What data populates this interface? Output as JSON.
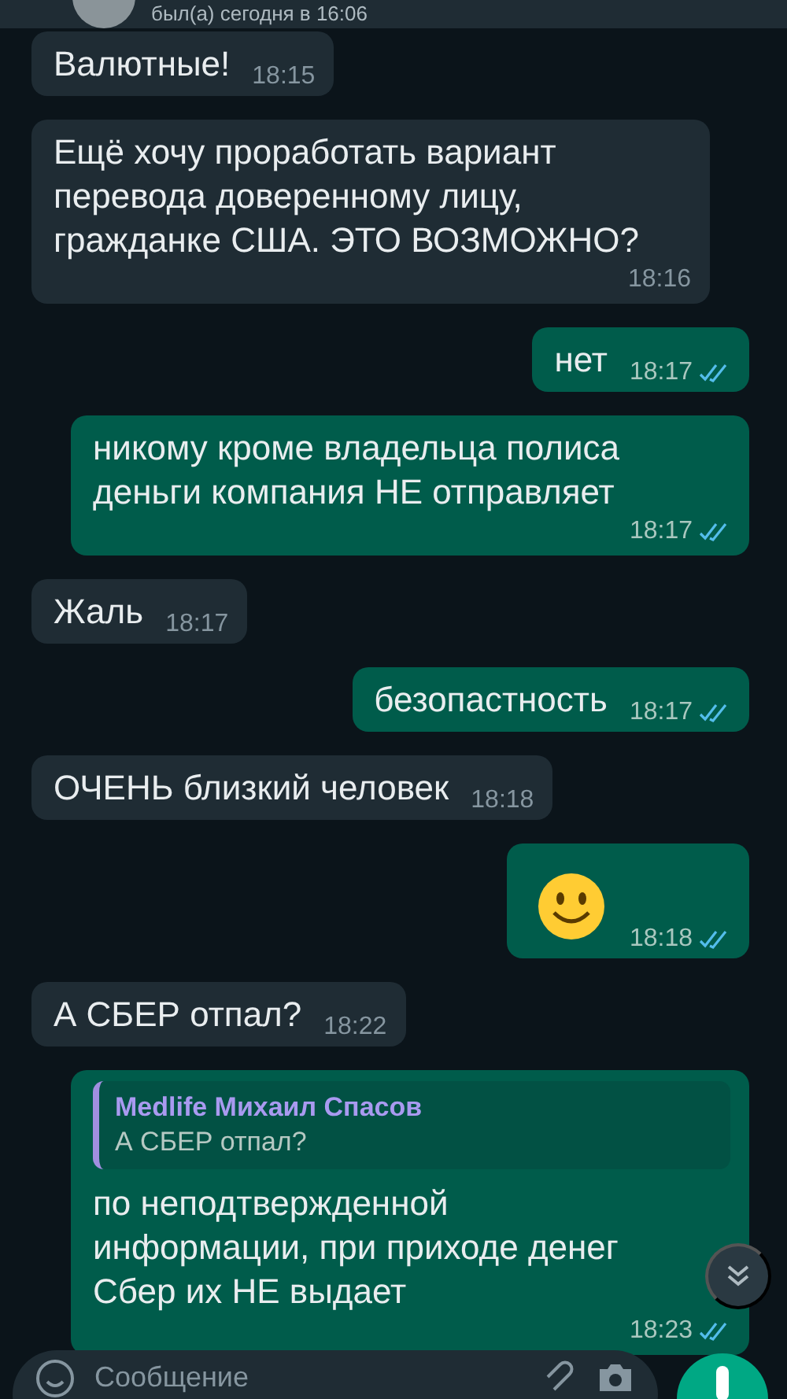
{
  "header": {
    "status": "был(а) сегодня в 16:06"
  },
  "messages": [
    {
      "kind": "text",
      "outgoing": false,
      "text": "Валютные!",
      "time": "18:15"
    },
    {
      "kind": "text",
      "outgoing": false,
      "text": "Ещё хочу проработать вариант\nперевода доверенному лицу,\nгражданке США. ЭТО ВОЗМОЖНО?",
      "time": "18:16"
    },
    {
      "kind": "text",
      "outgoing": true,
      "text": "нет",
      "time": "18:17",
      "read": true
    },
    {
      "kind": "text",
      "outgoing": true,
      "text": "никому кроме владельца полиса\nденьги компания НЕ отправляет",
      "time": "18:17",
      "read": true
    },
    {
      "kind": "text",
      "outgoing": false,
      "text": "Жаль",
      "time": "18:17"
    },
    {
      "kind": "text",
      "outgoing": true,
      "text": "безопастность",
      "time": "18:17",
      "read": true
    },
    {
      "kind": "text",
      "outgoing": false,
      "text": "ОЧЕНЬ близкий человек",
      "time": "18:18"
    },
    {
      "kind": "emoji",
      "outgoing": true,
      "time": "18:18",
      "read": true
    },
    {
      "kind": "text",
      "outgoing": false,
      "text": "А СБЕР отпал?",
      "time": "18:22"
    },
    {
      "kind": "text",
      "outgoing": true,
      "reply": {
        "author": "Medlife Михаил Спасов",
        "text": "А СБЕР отпал?"
      },
      "text": "по неподтвержденной\nинформации, при приходе денег\nСбер их НЕ выдает",
      "time": "18:23",
      "read": true
    }
  ],
  "composer": {
    "placeholder": "Сообщение"
  }
}
